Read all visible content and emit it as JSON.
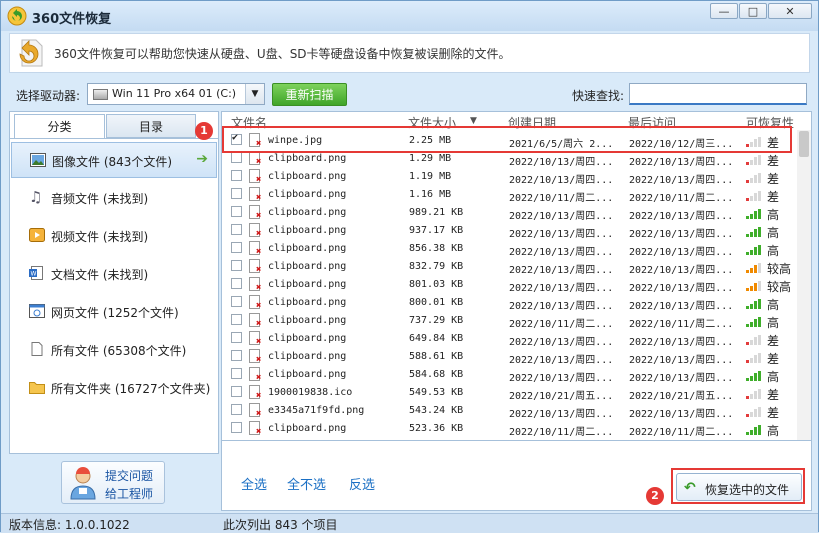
{
  "window": {
    "title": "360文件恢复",
    "min_label": "—",
    "max_label": "□",
    "close_label": "✕"
  },
  "banner": {
    "text": "360文件恢复可以帮助您快速从硬盘、U盘、SD卡等硬盘设备中恢复被误删除的文件。"
  },
  "toolbar": {
    "drive_label": "选择驱动器:",
    "drive_value": "Win 11 Pro x64 01 (C:)",
    "rescan_label": "重新扫描",
    "search_label": "快速查找:",
    "search_value": ""
  },
  "tabs": {
    "category": "分类",
    "directory": "目录"
  },
  "categories": [
    {
      "label": "图像文件 (843个文件)",
      "icon": "image-icon",
      "selected": true
    },
    {
      "label": "音频文件 (未找到)",
      "icon": "music-icon"
    },
    {
      "label": "视频文件 (未找到)",
      "icon": "video-icon"
    },
    {
      "label": "文档文件 (未找到)",
      "icon": "document-icon"
    },
    {
      "label": "网页文件 (1252个文件)",
      "icon": "web-icon"
    },
    {
      "label": "所有文件 (65308个文件)",
      "icon": "file-icon"
    },
    {
      "label": "所有文件夹 (16727个文件夹)",
      "icon": "folder-icon"
    }
  ],
  "support": {
    "line1": "提交问题",
    "line2": "给工程师"
  },
  "table": {
    "headers": {
      "name": "文件名",
      "size": "文件大小",
      "created": "创建日期",
      "accessed": "最后访问",
      "recover": "可恢复性"
    },
    "rows": [
      {
        "name": "winpe.jpg",
        "size": "2.25 MB",
        "created": "2021/6/5/周六 2...",
        "accessed": "2022/10/12/周三...",
        "level": 1,
        "recover": "差",
        "checked": true
      },
      {
        "name": "clipboard.png",
        "size": "1.29 MB",
        "created": "2022/10/13/周四...",
        "accessed": "2022/10/13/周四...",
        "level": 1,
        "recover": "差",
        "checked": false
      },
      {
        "name": "clipboard.png",
        "size": "1.19 MB",
        "created": "2022/10/13/周四...",
        "accessed": "2022/10/13/周四...",
        "level": 1,
        "recover": "差",
        "checked": false
      },
      {
        "name": "clipboard.png",
        "size": "1.16 MB",
        "created": "2022/10/11/周二...",
        "accessed": "2022/10/11/周二...",
        "level": 1,
        "recover": "差",
        "checked": false
      },
      {
        "name": "clipboard.png",
        "size": "989.21 KB",
        "created": "2022/10/13/周四...",
        "accessed": "2022/10/13/周四...",
        "level": 3,
        "recover": "高",
        "checked": false
      },
      {
        "name": "clipboard.png",
        "size": "937.17 KB",
        "created": "2022/10/13/周四...",
        "accessed": "2022/10/13/周四...",
        "level": 3,
        "recover": "高",
        "checked": false
      },
      {
        "name": "clipboard.png",
        "size": "856.38 KB",
        "created": "2022/10/13/周四...",
        "accessed": "2022/10/13/周四...",
        "level": 3,
        "recover": "高",
        "checked": false
      },
      {
        "name": "clipboard.png",
        "size": "832.79 KB",
        "created": "2022/10/13/周四...",
        "accessed": "2022/10/13/周四...",
        "level": 2,
        "recover": "较高",
        "checked": false
      },
      {
        "name": "clipboard.png",
        "size": "801.03 KB",
        "created": "2022/10/13/周四...",
        "accessed": "2022/10/13/周四...",
        "level": 2,
        "recover": "较高",
        "checked": false
      },
      {
        "name": "clipboard.png",
        "size": "800.01 KB",
        "created": "2022/10/13/周四...",
        "accessed": "2022/10/13/周四...",
        "level": 3,
        "recover": "高",
        "checked": false
      },
      {
        "name": "clipboard.png",
        "size": "737.29 KB",
        "created": "2022/10/11/周二...",
        "accessed": "2022/10/11/周二...",
        "level": 3,
        "recover": "高",
        "checked": false
      },
      {
        "name": "clipboard.png",
        "size": "649.84 KB",
        "created": "2022/10/13/周四...",
        "accessed": "2022/10/13/周四...",
        "level": 1,
        "recover": "差",
        "checked": false
      },
      {
        "name": "clipboard.png",
        "size": "588.61 KB",
        "created": "2022/10/13/周四...",
        "accessed": "2022/10/13/周四...",
        "level": 1,
        "recover": "差",
        "checked": false
      },
      {
        "name": "clipboard.png",
        "size": "584.68 KB",
        "created": "2022/10/13/周四...",
        "accessed": "2022/10/13/周四...",
        "level": 3,
        "recover": "高",
        "checked": false
      },
      {
        "name": "1900019838.ico",
        "size": "549.53 KB",
        "created": "2022/10/21/周五...",
        "accessed": "2022/10/21/周五...",
        "level": 1,
        "recover": "差",
        "checked": false
      },
      {
        "name": "e3345a71f9fd.png",
        "size": "543.24 KB",
        "created": "2022/10/13/周四...",
        "accessed": "2022/10/13/周四...",
        "level": 1,
        "recover": "差",
        "checked": false
      },
      {
        "name": "clipboard.png",
        "size": "523.36 KB",
        "created": "2022/10/11/周二...",
        "accessed": "2022/10/11/周二...",
        "level": 3,
        "recover": "高",
        "checked": false
      }
    ]
  },
  "actions": {
    "select_all": "全选",
    "select_none": "全不选",
    "invert": "反选",
    "restore": "恢复选中的文件"
  },
  "status": {
    "version": "版本信息: 1.0.0.1022",
    "listed": "此次列出 843 个项目"
  },
  "annotations": {
    "marker1": "1",
    "marker2": "2"
  },
  "colors": {
    "highlight": "#e53935",
    "bar_good": "#3fae2a",
    "bar_mid": "#f08a00",
    "bar_poor": "#e23b3b",
    "bar_empty": "#d8d8d8",
    "link": "#1a6fc4"
  }
}
